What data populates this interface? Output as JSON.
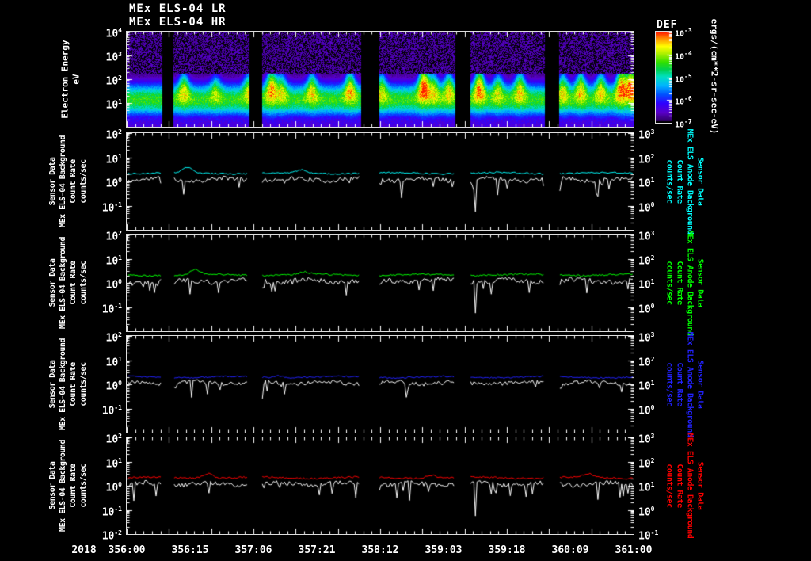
{
  "header": {
    "title_lr": "MEx ELS-04 LR",
    "title_hr": "MEx ELS-04 HR"
  },
  "x_axis": {
    "year": "2018",
    "labels": [
      "356:00",
      "356:15",
      "357:06",
      "357:21",
      "358:12",
      "359:03",
      "359:18",
      "360:09",
      "361:00"
    ],
    "hours_total": 120,
    "minor_tick_hours": 2,
    "major_tick_hours": 10
  },
  "panel_labels": {
    "left_lines": [
      "Sensor Data",
      "MEx ELS-04 Background",
      "Count Rate",
      "counts/sec"
    ],
    "right_lines": [
      "Sensor Data",
      "MEx ELS Anode Background",
      "Count Rate",
      "counts/sec"
    ]
  },
  "chart_data": [
    {
      "type": "heatmap",
      "name": "electron-energy-spectrogram",
      "title": "MEx ELS-04 HR",
      "ylabel": "Electron Energy (eV)",
      "ylabel_lines": [
        "Electron Energy",
        "eV"
      ],
      "y_log_range": [
        0,
        4
      ],
      "ytick_exponents": [
        4,
        3,
        2,
        1
      ],
      "x_start": "2018 356:00",
      "x_end": "2018 361:00",
      "colorbar": {
        "title": "DEF",
        "unit": "ergs/(cm**2-sr-sec-eV)",
        "z_log_range": [
          -7,
          -3
        ],
        "tick_exponents": [
          -3,
          -4,
          -5,
          -6,
          -7
        ],
        "palette_stops": [
          [
            0.0,
            "#2e0060"
          ],
          [
            0.1,
            "#5a00c8"
          ],
          [
            0.2,
            "#3000ff"
          ],
          [
            0.3,
            "#0050ff"
          ],
          [
            0.4,
            "#00b4ff"
          ],
          [
            0.5,
            "#00e0c0"
          ],
          [
            0.58,
            "#00d050"
          ],
          [
            0.66,
            "#30e000"
          ],
          [
            0.76,
            "#b0f000"
          ],
          [
            0.84,
            "#ffff00"
          ],
          [
            0.92,
            "#ff9800"
          ],
          [
            1.0,
            "#ff1800"
          ]
        ]
      },
      "bands": {
        "main_band_center_logE": 1.15,
        "main_band_sigma": 0.5,
        "noise_region_above_logE": 2.25,
        "bottom_level": 0.3
      },
      "gaps_frac": [
        [
          0.069,
          0.092
        ],
        [
          0.242,
          0.266
        ],
        [
          0.461,
          0.497
        ],
        [
          0.648,
          0.677
        ],
        [
          0.825,
          0.853
        ]
      ],
      "plumes": [
        [
          0.112,
          0.55
        ],
        [
          0.175,
          0.35
        ],
        [
          0.24,
          0.5
        ],
        [
          0.285,
          0.75
        ],
        [
          0.305,
          0.45
        ],
        [
          0.365,
          0.55
        ],
        [
          0.44,
          0.65
        ],
        [
          0.502,
          0.5
        ],
        [
          0.585,
          0.95
        ],
        [
          0.605,
          0.5
        ],
        [
          0.635,
          0.55
        ],
        [
          0.695,
          0.8
        ],
        [
          0.732,
          0.45
        ],
        [
          0.775,
          0.6
        ],
        [
          0.86,
          0.5
        ],
        [
          0.895,
          0.6
        ],
        [
          0.935,
          0.55
        ],
        [
          0.975,
          0.85
        ],
        [
          0.995,
          0.9
        ]
      ]
    },
    {
      "type": "line",
      "name": "els04-background-vs-anode-background-cyan",
      "seed": 11,
      "left_axis": {
        "label": "Sensor Data MEx ELS-04 Background Count Rate (counts/sec)",
        "log_range": [
          -2,
          2
        ],
        "tick_exponents": [
          2,
          1,
          0,
          -1
        ]
      },
      "right_axis": {
        "label": "Sensor Data MEx ELS Anode Background Count Rate (counts/sec)",
        "log_range": [
          -1,
          3
        ],
        "tick_exponents": [
          3,
          2,
          1,
          0
        ]
      },
      "series": [
        {
          "name": "MEx ELS-04 Background Count Rate",
          "color": "#ffffff",
          "base_log10": 0.08,
          "noise": 0.09
        },
        {
          "name": "MEx ELS Anode Background Count Rate",
          "color": "#00ffff",
          "base_log10": 0.34,
          "noise": 0.03,
          "bumps": [
            [
              0.12,
              0.22
            ],
            [
              0.345,
              0.12
            ]
          ]
        }
      ],
      "deep_spikes_frac": [
        0.688
      ]
    },
    {
      "type": "line",
      "name": "els04-background-vs-anode-background-green",
      "seed": 22,
      "left_axis": {
        "label": "Sensor Data MEx ELS-04 Background Count Rate (counts/sec)",
        "log_range": [
          -2,
          2
        ],
        "tick_exponents": [
          2,
          1,
          0,
          -1
        ]
      },
      "right_axis": {
        "label": "Sensor Data MEx ELS Anode Background Count Rate (counts/sec)",
        "log_range": [
          -1,
          3
        ],
        "tick_exponents": [
          3,
          2,
          1,
          0
        ]
      },
      "series": [
        {
          "name": "MEx ELS-04 Background Count Rate",
          "color": "#ffffff",
          "base_log10": 0.08,
          "noise": 0.1
        },
        {
          "name": "MEx ELS Anode Background Count Rate",
          "color": "#00ff00",
          "base_log10": 0.33,
          "noise": 0.035,
          "bumps": [
            [
              0.135,
              0.18
            ],
            [
              0.35,
              0.1
            ]
          ]
        }
      ],
      "deep_spikes_frac": [
        0.688
      ]
    },
    {
      "type": "line",
      "name": "els04-background-vs-anode-background-blue",
      "seed": 33,
      "left_axis": {
        "label": "Sensor Data MEx ELS-04 Background Count Rate (counts/sec)",
        "log_range": [
          -2,
          2
        ],
        "tick_exponents": [
          2,
          1,
          0,
          -1
        ]
      },
      "right_axis": {
        "label": "Sensor Data MEx ELS Anode Background Count Rate (counts/sec)",
        "log_range": [
          -1,
          3
        ],
        "tick_exponents": [
          3,
          2,
          1,
          0
        ]
      },
      "series": [
        {
          "name": "MEx ELS-04 Background Count Rate",
          "color": "#ffffff",
          "base_log10": 0.06,
          "noise": 0.08
        },
        {
          "name": "MEx ELS Anode Background Count Rate",
          "color": "#2222ff",
          "base_log10": 0.3,
          "noise": 0.03,
          "bumps": [
            [
              0.3,
              0.08
            ]
          ]
        }
      ],
      "deep_spikes_frac": []
    },
    {
      "type": "line",
      "name": "els04-background-vs-anode-background-red",
      "seed": 44,
      "left_axis": {
        "label": "Sensor Data MEx ELS-04 Background Count Rate (counts/sec)",
        "log_range": [
          -2,
          2
        ],
        "tick_exponents": [
          2,
          1,
          0,
          -1,
          -2
        ]
      },
      "right_axis": {
        "label": "Sensor Data MEx ELS Anode Background Count Rate (counts/sec)",
        "log_range": [
          -1,
          3
        ],
        "tick_exponents": [
          3,
          2,
          1,
          0,
          -1
        ]
      },
      "series": [
        {
          "name": "MEx ELS-04 Background Count Rate",
          "color": "#ffffff",
          "base_log10": 0.07,
          "noise": 0.09
        },
        {
          "name": "MEx ELS Anode Background Count Rate",
          "color": "#ff0000",
          "base_log10": 0.33,
          "noise": 0.035,
          "bumps": [
            [
              0.16,
              0.2
            ],
            [
              0.6,
              0.12
            ],
            [
              0.91,
              0.15
            ]
          ]
        }
      ],
      "deep_spikes_frac": [
        0.688
      ]
    }
  ]
}
